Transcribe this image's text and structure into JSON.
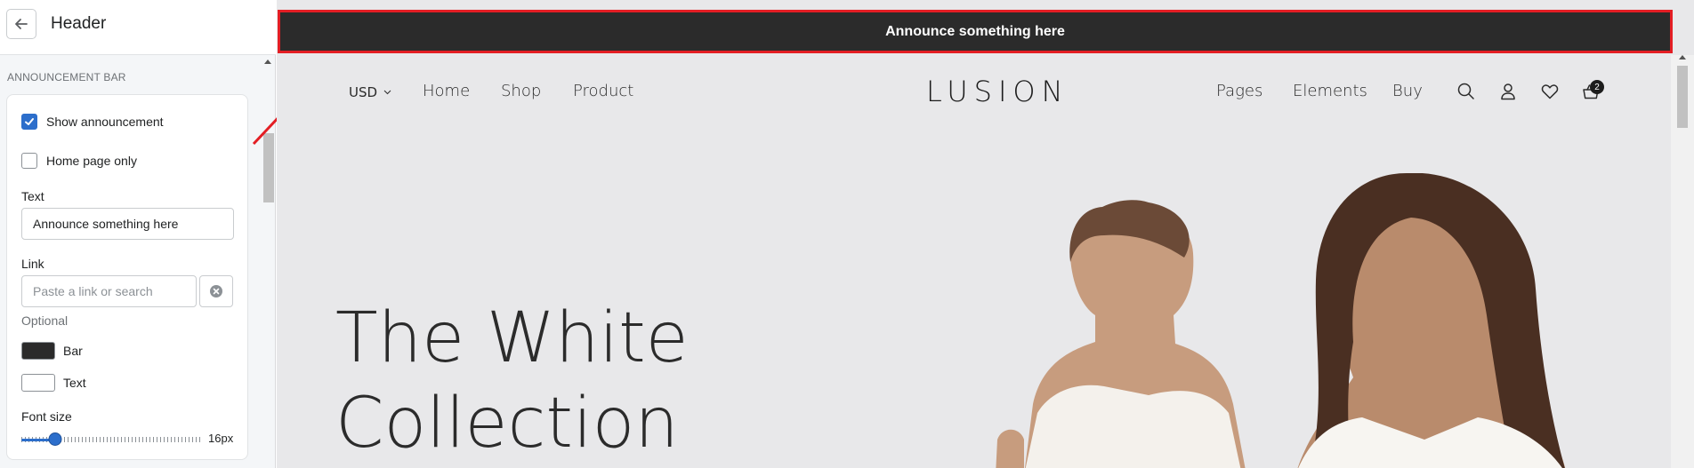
{
  "panel": {
    "title": "Header",
    "section_label": "ANNOUNCEMENT BAR",
    "show_announcement": {
      "label": "Show announcement",
      "checked": true
    },
    "home_page_only": {
      "label": "Home page only",
      "checked": false
    },
    "text_field": {
      "label": "Text",
      "value": "Announce something here"
    },
    "link_field": {
      "label": "Link",
      "placeholder": "Paste a link or search",
      "hint": "Optional"
    },
    "colors": [
      {
        "label": "Bar",
        "color": "#2b2b2b"
      },
      {
        "label": "Text",
        "color": "#ffffff"
      }
    ],
    "font_size": {
      "label": "Font size",
      "value": "16px",
      "level": 0.19
    },
    "accent_color": "#2c6ecb"
  },
  "preview": {
    "announcement_text": "Announce something here",
    "announcement_bg": "#2b2b2b",
    "highlight_color": "#e31e24",
    "currency": "USD",
    "nav_left": [
      "Home",
      "Shop",
      "Product"
    ],
    "logo": "LUSION",
    "nav_right": [
      "Pages",
      "Elements",
      "Buy"
    ],
    "icons": [
      "search-icon",
      "account-icon",
      "wishlist-icon",
      "cart-icon"
    ],
    "cart_count": "2",
    "hero_line1": "The White",
    "hero_line2": "Collection"
  }
}
